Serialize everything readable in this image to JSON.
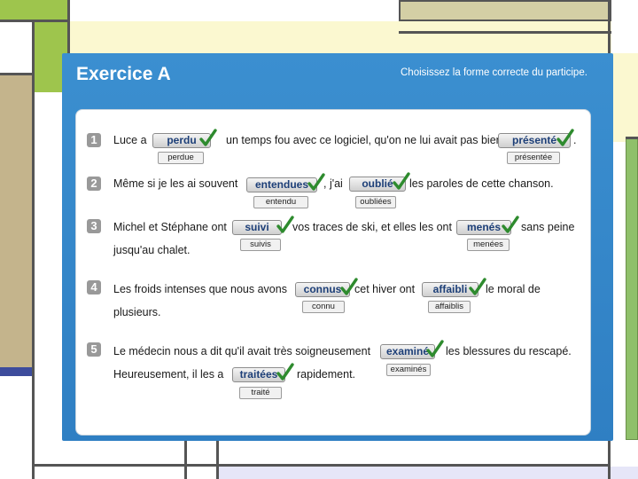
{
  "exercise": {
    "title": "Exercice A",
    "instruction": "Choisissez la forme correcte du participe."
  },
  "items": [
    {
      "number": "1",
      "segments": [
        "Luce a",
        "un temps fou avec ce logiciel, qu'on ne lui avait pas bien",
        "."
      ],
      "answers": [
        "perdu",
        "présenté"
      ],
      "keys": [
        "perdue",
        "présentée"
      ]
    },
    {
      "number": "2",
      "segments": [
        "Même si je les ai souvent",
        ", j'ai",
        "les paroles de cette chanson."
      ],
      "answers": [
        "entendues",
        "oublié"
      ],
      "keys": [
        "entendu",
        "oubliées"
      ]
    },
    {
      "number": "3",
      "segments": [
        "Michel et Stéphane ont",
        "vos traces de ski, et elles les ont",
        "sans peine",
        "jusqu'au chalet."
      ],
      "answers": [
        "suivi",
        "menés"
      ],
      "keys": [
        "suivis",
        "menées"
      ]
    },
    {
      "number": "4",
      "segments": [
        "Les froids intenses que nous avons",
        "cet hiver ont",
        "le moral de",
        "plusieurs."
      ],
      "answers": [
        "connus",
        "affaibli"
      ],
      "keys": [
        "connu",
        "affaiblis"
      ]
    },
    {
      "number": "5",
      "segments": [
        "Le médecin nous a dit qu'il avait très soigneusement",
        "les blessures du rescapé.",
        "Heureusement, il les a",
        "rapidement."
      ],
      "answers": [
        "examiné",
        "traitées"
      ],
      "keys": [
        "examinés",
        "traité"
      ]
    }
  ],
  "colors": {
    "panel_blue": "#3b8fd0",
    "check_green": "#2e8b2e",
    "answer_text": "#1d3f78",
    "frame_green": "#9ec54d"
  },
  "icons": {
    "check": "check-icon"
  }
}
